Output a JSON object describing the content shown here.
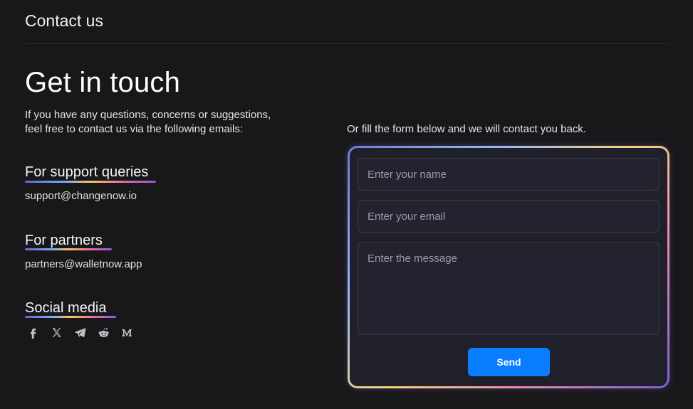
{
  "header": {
    "title": "Contact us"
  },
  "main": {
    "headline": "Get in touch",
    "intro_line1": "If you have any questions, concerns or suggestions,",
    "intro_line2": "feel free to contact us via the following emails:"
  },
  "support": {
    "title": "For support queries",
    "email": "support@changenow.io"
  },
  "partners": {
    "title": "For partners",
    "email": "partners@walletnow.app"
  },
  "social": {
    "title": "Social media",
    "icons": [
      "facebook-icon",
      "x-icon",
      "telegram-icon",
      "reddit-icon",
      "medium-icon"
    ]
  },
  "form": {
    "caption": "Or fill the form below and we will contact you back.",
    "name_placeholder": "Enter your name",
    "email_placeholder": "Enter your email",
    "message_placeholder": "Enter the message",
    "send_label": "Send"
  },
  "colors": {
    "background": "#18181b",
    "form_background": "#1f2029",
    "accent": "#0a7cff"
  }
}
